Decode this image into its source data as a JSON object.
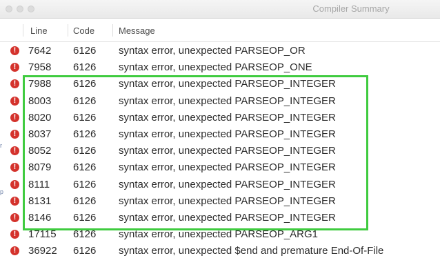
{
  "window": {
    "title": "Compiler Summary"
  },
  "columns": {
    "line": "Line",
    "code": "Code",
    "message": "Message"
  },
  "colors": {
    "error_icon": "#d4322c",
    "highlight": "#3fcb3f"
  },
  "rows": [
    {
      "icon": "error-icon",
      "line": "7642",
      "code": "6126",
      "message": "syntax error, unexpected PARSEOP_OR"
    },
    {
      "icon": "error-icon",
      "line": "7958",
      "code": "6126",
      "message": "syntax error, unexpected PARSEOP_ONE"
    },
    {
      "icon": "error-icon",
      "line": "7988",
      "code": "6126",
      "message": "syntax error, unexpected PARSEOP_INTEGER"
    },
    {
      "icon": "error-icon",
      "line": "8003",
      "code": "6126",
      "message": "syntax error, unexpected PARSEOP_INTEGER"
    },
    {
      "icon": "error-icon",
      "line": "8020",
      "code": "6126",
      "message": "syntax error, unexpected PARSEOP_INTEGER"
    },
    {
      "icon": "error-icon",
      "line": "8037",
      "code": "6126",
      "message": "syntax error, unexpected PARSEOP_INTEGER"
    },
    {
      "icon": "error-icon",
      "line": "8052",
      "code": "6126",
      "message": "syntax error, unexpected PARSEOP_INTEGER"
    },
    {
      "icon": "error-icon",
      "line": "8079",
      "code": "6126",
      "message": "syntax error, unexpected PARSEOP_INTEGER"
    },
    {
      "icon": "error-icon",
      "line": "8111",
      "code": "6126",
      "message": "syntax error, unexpected PARSEOP_INTEGER"
    },
    {
      "icon": "error-icon",
      "line": "8131",
      "code": "6126",
      "message": "syntax error, unexpected PARSEOP_INTEGER"
    },
    {
      "icon": "error-icon",
      "line": "8146",
      "code": "6126",
      "message": "syntax error, unexpected PARSEOP_INTEGER"
    },
    {
      "icon": "error-icon",
      "line": "17115",
      "code": "6126",
      "message": "syntax error, unexpected PARSEOP_ARG1"
    },
    {
      "icon": "error-icon",
      "line": "36922",
      "code": "6126",
      "message": "syntax error, unexpected $end and premature End-Of-File"
    }
  ]
}
